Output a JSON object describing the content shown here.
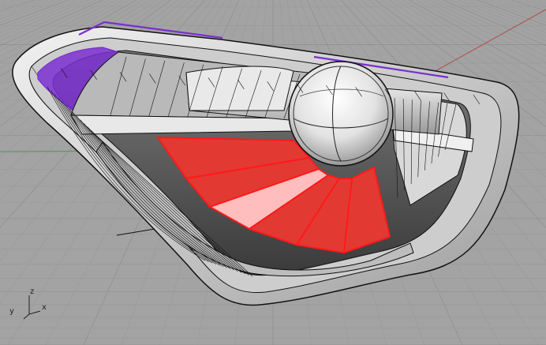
{
  "viewport": {
    "background_color": "#a3a3a3",
    "grid_minor_color": "#9a9a9a",
    "grid_major_color": "#8e8e8e",
    "world_x_axis_color": "#b24a4a",
    "world_y_axis_color": "#4f9a4f"
  },
  "axis_indicator": {
    "x_label": "x",
    "y_label": "y",
    "z_label": "z"
  },
  "model": {
    "shell_fill": "#d2d2d2",
    "shell_highlight": "#f4f4f4",
    "edge_color": "#111111",
    "selected_color": "#7a2fd0",
    "fan_color": "#e23a33",
    "fan_highlight": "#ffbdbd",
    "fan_edge": "#ff1a1a"
  }
}
